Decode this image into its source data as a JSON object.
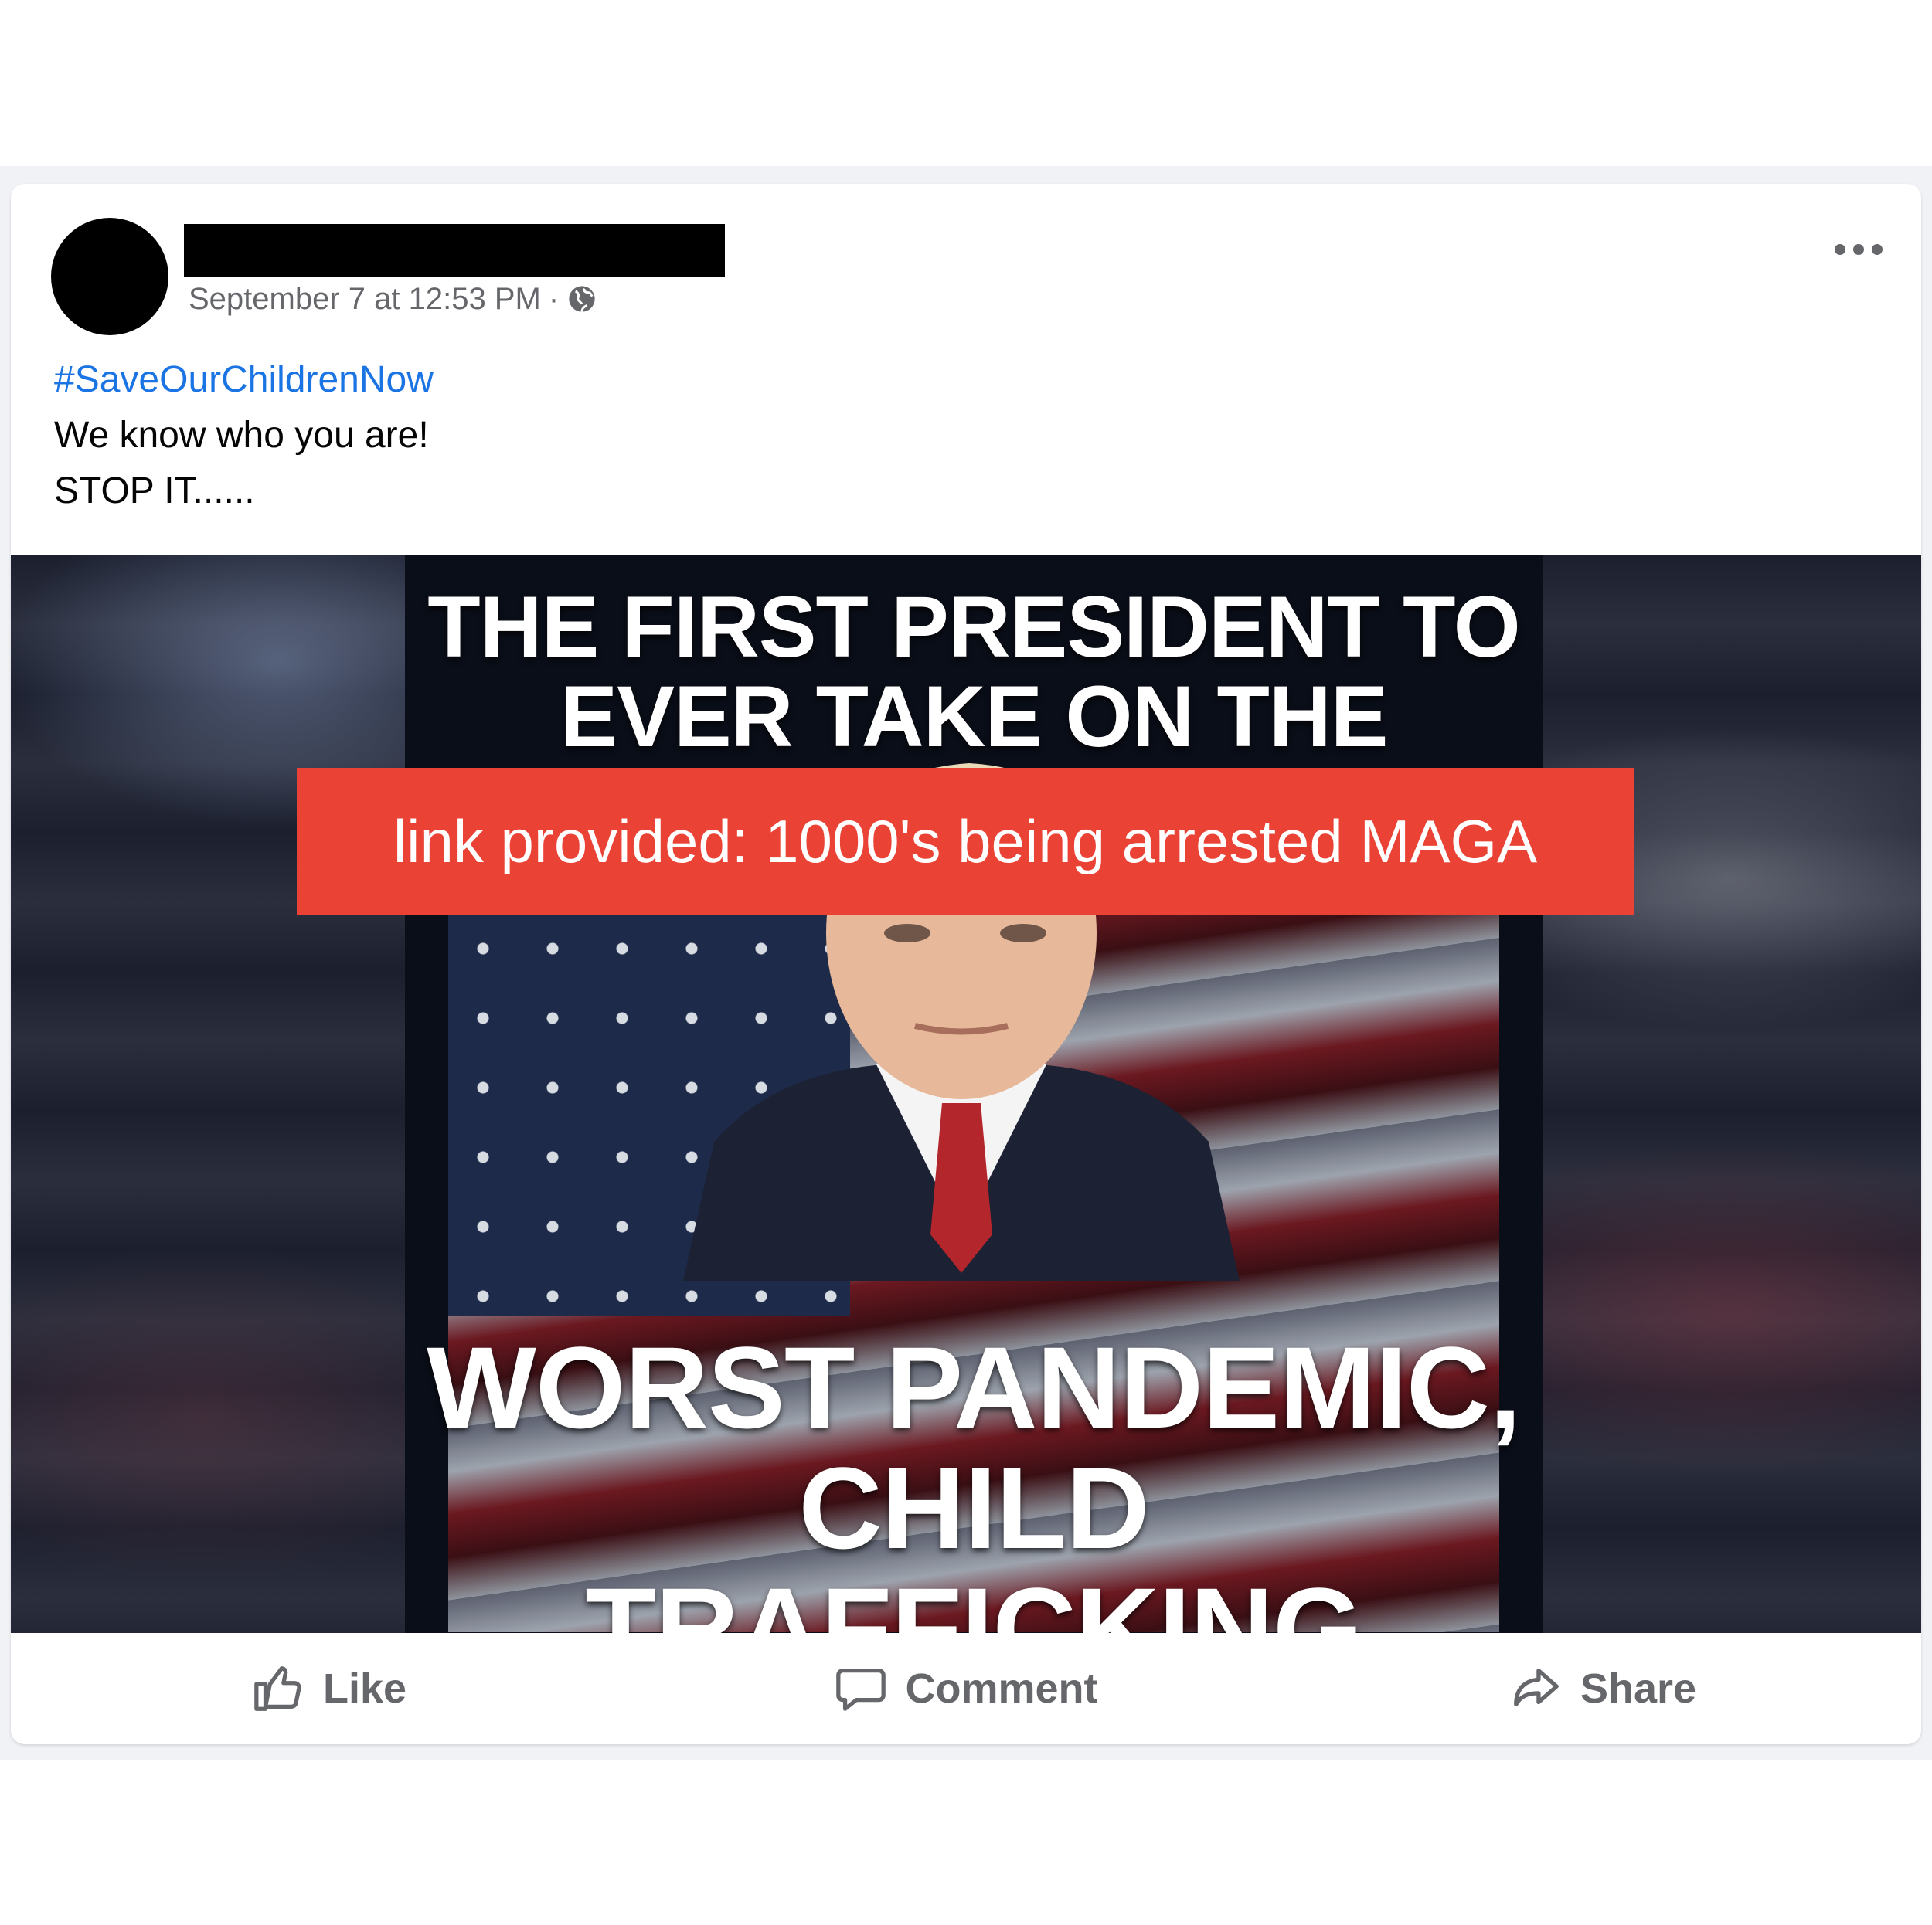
{
  "post": {
    "timestamp": "September 7 at 12:53 PM",
    "separator": "·",
    "hashtag": "#SaveOurChildrenNow",
    "lines": [
      "We know who you are!",
      "STOP IT......"
    ]
  },
  "media": {
    "headline_top_1": "THE FIRST PRESIDENT TO",
    "headline_top_2": "EVER TAKE ON THE WORLD'S",
    "link_banner": "link provided: 1000's being arrested MAGA",
    "headline_bottom_1": "WORST PANDEMIC,",
    "headline_bottom_2": "CHILD TRAFFICKING"
  },
  "actions": {
    "like": "Like",
    "comment": "Comment",
    "share": "Share"
  },
  "icons": {
    "privacy": "globe-icon",
    "menu": "more-options-icon",
    "like": "thumbs-up-icon",
    "comment": "comment-bubble-icon",
    "share": "share-arrow-icon"
  },
  "colors": {
    "hashtag": "#1b74e4",
    "link_banner": "#ea4335",
    "secondary_text": "#65676b"
  }
}
